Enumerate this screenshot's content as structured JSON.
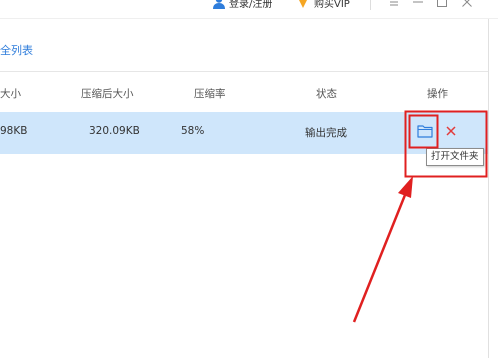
{
  "header": {
    "login_label": "登录/注册",
    "vip_label": "购买VIP",
    "icons": {
      "user": "user-icon",
      "vip": "vip-icon",
      "menu": "menu-icon",
      "minimize": "minimize-icon",
      "maximize": "maximize-icon",
      "close": "close-icon"
    }
  },
  "list_link": "全列表",
  "table": {
    "headers": {
      "size": "大小",
      "after_size": "压缩后大小",
      "ratio": "压缩率",
      "status": "状态",
      "ops": "操作"
    },
    "rows": [
      {
        "size": "98KB",
        "after_size": "320.09KB",
        "ratio": "58%",
        "status": "输出完成"
      }
    ]
  },
  "tooltip": "打开文件夹",
  "colors": {
    "accent": "#2f7ddb",
    "row_selected": "#cfe6fb",
    "annotation_red": "#e02020",
    "delete_red": "#e23b3b"
  }
}
